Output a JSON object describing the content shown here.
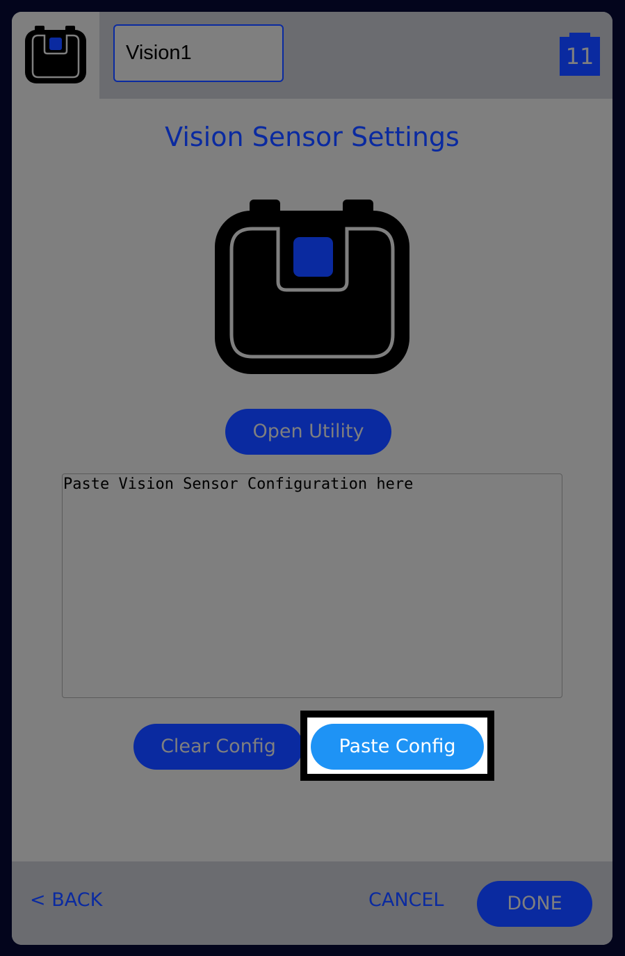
{
  "header": {
    "device_icon": "vision-sensor-icon",
    "name_value": "Vision1",
    "port_number": "11"
  },
  "title": "Vision Sensor Settings",
  "sensor_image": "vision-sensor-icon",
  "buttons": {
    "open_utility": "Open Utility",
    "clear_config": "Clear Config",
    "paste_config": "Paste Config"
  },
  "config_field": {
    "value": "",
    "placeholder": "Paste Vision Sensor Configuration here"
  },
  "footer": {
    "back": "< BACK",
    "cancel": "CANCEL",
    "done": "DONE"
  },
  "colors": {
    "background": "#7f7f7f",
    "header_bar": "#6b6c70",
    "accent": "#0a2aa0",
    "active_button": "#1e93f5"
  }
}
